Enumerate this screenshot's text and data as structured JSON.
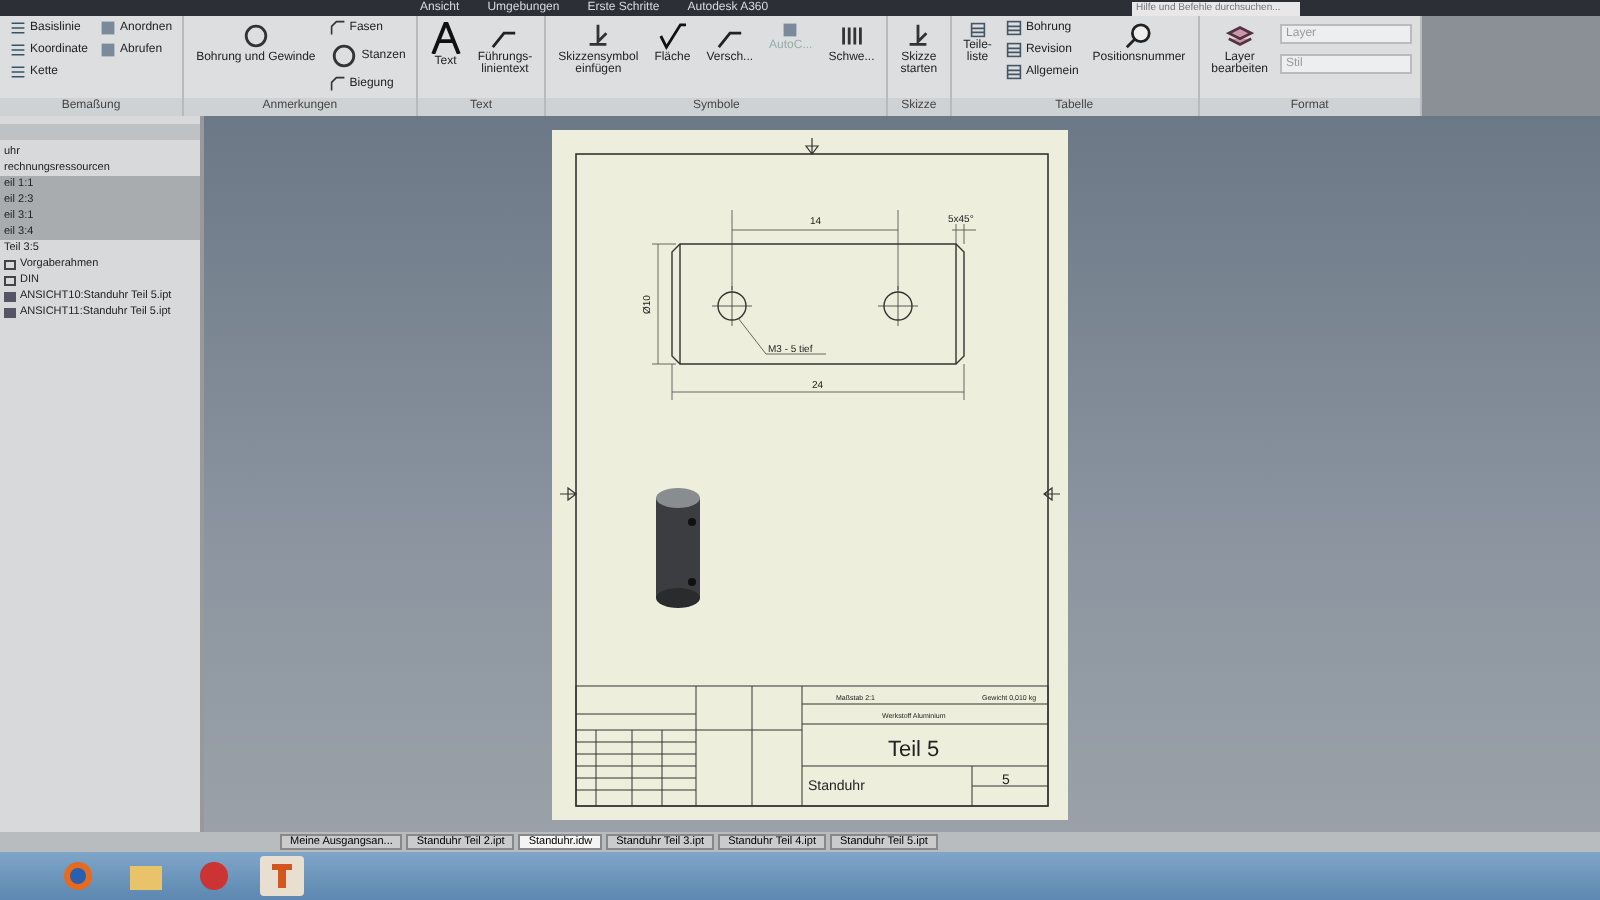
{
  "ribbon_tabs": [
    {
      "label": "Ansicht",
      "selected": false
    },
    {
      "label": "Umgebungen",
      "selected": false
    },
    {
      "label": "Erste Schritte",
      "selected": false
    },
    {
      "label": "Autodesk A360",
      "selected": false
    }
  ],
  "search": {
    "placeholder": "Hilfe und Befehle durchsuchen..."
  },
  "ribbon_groups": [
    {
      "title": "Bemaßung",
      "items": [
        {
          "kind": "small",
          "label": "Basislinie",
          "disabled": false
        },
        {
          "kind": "small",
          "label": "Koordinate",
          "disabled": false
        },
        {
          "kind": "small",
          "label": "Kette",
          "disabled": false
        },
        {
          "kind": "small",
          "label": "Anordnen",
          "disabled": false
        },
        {
          "kind": "small",
          "label": "Abrufen",
          "disabled": false
        }
      ]
    },
    {
      "title": "Anmerkungen",
      "items": [
        {
          "kind": "large",
          "label": "Bohrung und Gewinde",
          "disabled": false
        },
        {
          "kind": "small",
          "label": "Fasen",
          "disabled": false
        },
        {
          "kind": "small",
          "label": "Stanzen",
          "disabled": false
        },
        {
          "kind": "small",
          "label": "Biegung",
          "disabled": false
        }
      ]
    },
    {
      "title": "Text",
      "items": [
        {
          "kind": "large",
          "label": "Text",
          "disabled": false
        },
        {
          "kind": "large",
          "label": "Führungs-\nlinientext",
          "disabled": false
        }
      ]
    },
    {
      "title": "Symbole",
      "items": [
        {
          "kind": "large",
          "label": "Skizzensymbol\neinfügen",
          "disabled": false
        },
        {
          "kind": "large",
          "label": "Fläche",
          "disabled": false
        },
        {
          "kind": "large",
          "label": "Versch...",
          "disabled": false
        },
        {
          "kind": "large",
          "label": "AutoC...",
          "disabled": true
        },
        {
          "kind": "large",
          "label": "Schwe...",
          "disabled": false
        }
      ]
    },
    {
      "title": "Skizze",
      "items": [
        {
          "kind": "large",
          "label": "Skizze\nstarten",
          "disabled": false
        }
      ]
    },
    {
      "title": "Tabelle",
      "items": [
        {
          "kind": "large",
          "label": "Teile-\nliste",
          "disabled": false
        },
        {
          "kind": "small",
          "label": "Bohrung",
          "disabled": false
        },
        {
          "kind": "small",
          "label": "Revision",
          "disabled": false
        },
        {
          "kind": "small",
          "label": "Allgemein",
          "disabled": false
        },
        {
          "kind": "large",
          "label": "Positionsnummer",
          "disabled": false
        }
      ]
    },
    {
      "title": "Format",
      "items": [
        {
          "kind": "large",
          "label": "Layer\nbearbeiten",
          "disabled": false
        },
        {
          "kind": "dropdown",
          "label": "Layer",
          "disabled": true
        },
        {
          "kind": "dropdown",
          "label": "Stil",
          "disabled": true
        }
      ]
    }
  ],
  "browser": {
    "items": [
      {
        "kind": "text",
        "label": "uhr",
        "selected": false
      },
      {
        "kind": "text",
        "label": "rechnungsressourcen",
        "selected": false
      },
      {
        "kind": "text",
        "label": "eil 1:1",
        "selected": true
      },
      {
        "kind": "text",
        "label": "eil 2:3",
        "selected": true
      },
      {
        "kind": "text",
        "label": "eil 3:1",
        "selected": true
      },
      {
        "kind": "text",
        "label": "eil 3:4",
        "selected": true
      },
      {
        "kind": "text",
        "label": "Teil 3:5",
        "selected": false
      },
      {
        "kind": "frame",
        "label": "Vorgaberahmen",
        "selected": false
      },
      {
        "kind": "frame",
        "label": "DIN",
        "selected": false
      },
      {
        "kind": "view",
        "label": "ANSICHT10:Standuhr Teil 5.ipt",
        "selected": false
      },
      {
        "kind": "view",
        "label": "ANSICHT11:Standuhr Teil 5.ipt",
        "selected": false
      }
    ]
  },
  "drawing": {
    "dimensions": {
      "hole_spacing": "14",
      "chamfer": "5x45°",
      "diameter": "Ø10",
      "thread": "M3 - 5 tief",
      "length": "24"
    },
    "title_block": {
      "scale": "Maßstab 2:1",
      "weight": "Gewicht 0,010 kg",
      "material": "Werkstoff Aluminium",
      "title": "Teil 5",
      "assembly": "Standuhr",
      "sheet": "5"
    }
  },
  "document_tabs": [
    {
      "label": "Meine Ausgangsan...",
      "selected": false
    },
    {
      "label": "Standuhr Teil 2.ipt",
      "selected": false
    },
    {
      "label": "Standuhr.idw",
      "selected": true
    },
    {
      "label": "Standuhr Teil 3.ipt",
      "selected": false
    },
    {
      "label": "Standuhr Teil 4.ipt",
      "selected": false
    },
    {
      "label": "Standuhr Teil 5.ipt",
      "selected": false
    }
  ]
}
